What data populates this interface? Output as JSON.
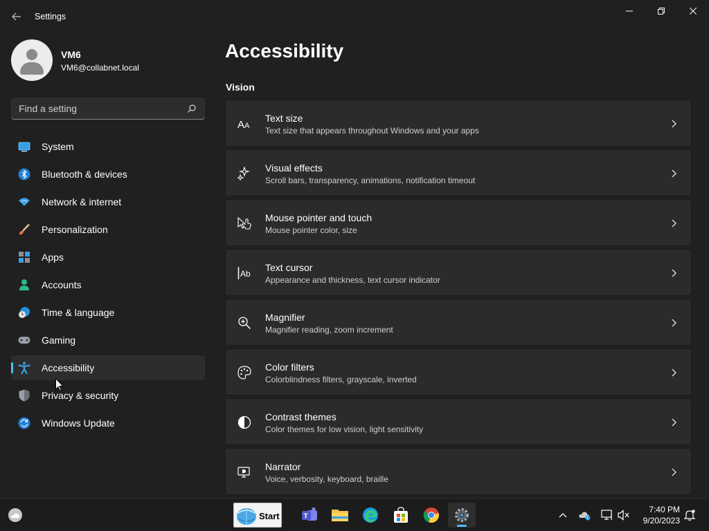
{
  "window": {
    "title": "Settings"
  },
  "profile": {
    "name": "VM6",
    "email": "VM6@collabnet.local"
  },
  "search": {
    "placeholder": "Find a setting"
  },
  "nav": {
    "items": [
      {
        "label": "System",
        "icon": "system-icon"
      },
      {
        "label": "Bluetooth & devices",
        "icon": "bluetooth-icon"
      },
      {
        "label": "Network & internet",
        "icon": "wifi-icon"
      },
      {
        "label": "Personalization",
        "icon": "brush-icon"
      },
      {
        "label": "Apps",
        "icon": "apps-icon"
      },
      {
        "label": "Accounts",
        "icon": "accounts-icon"
      },
      {
        "label": "Time & language",
        "icon": "globe-clock-icon"
      },
      {
        "label": "Gaming",
        "icon": "gamepad-icon"
      },
      {
        "label": "Accessibility",
        "icon": "accessibility-icon",
        "selected": true
      },
      {
        "label": "Privacy & security",
        "icon": "shield-icon"
      },
      {
        "label": "Windows Update",
        "icon": "update-icon"
      }
    ]
  },
  "main": {
    "title": "Accessibility",
    "section": "Vision",
    "cards": [
      {
        "title": "Text size",
        "desc": "Text size that appears throughout Windows and your apps",
        "icon": "text-size-icon"
      },
      {
        "title": "Visual effects",
        "desc": "Scroll bars, transparency, animations, notification timeout",
        "icon": "visual-effects-icon"
      },
      {
        "title": "Mouse pointer and touch",
        "desc": "Mouse pointer color, size",
        "icon": "pointer-touch-icon"
      },
      {
        "title": "Text cursor",
        "desc": "Appearance and thickness, text cursor indicator",
        "icon": "text-cursor-icon"
      },
      {
        "title": "Magnifier",
        "desc": "Magnifier reading, zoom increment",
        "icon": "magnifier-icon"
      },
      {
        "title": "Color filters",
        "desc": "Colorblindness filters, grayscale, inverted",
        "icon": "palette-icon"
      },
      {
        "title": "Contrast themes",
        "desc": "Color themes for low vision, light sensitivity",
        "icon": "contrast-icon"
      },
      {
        "title": "Narrator",
        "desc": "Voice, verbosity, keyboard, braille",
        "icon": "narrator-icon"
      }
    ]
  },
  "taskbar": {
    "start_label": "Start",
    "time": "7:40 PM",
    "date": "9/20/2023"
  },
  "colors": {
    "accent": "#4cc2ff",
    "background": "#202020",
    "card": "#2b2b2b"
  }
}
